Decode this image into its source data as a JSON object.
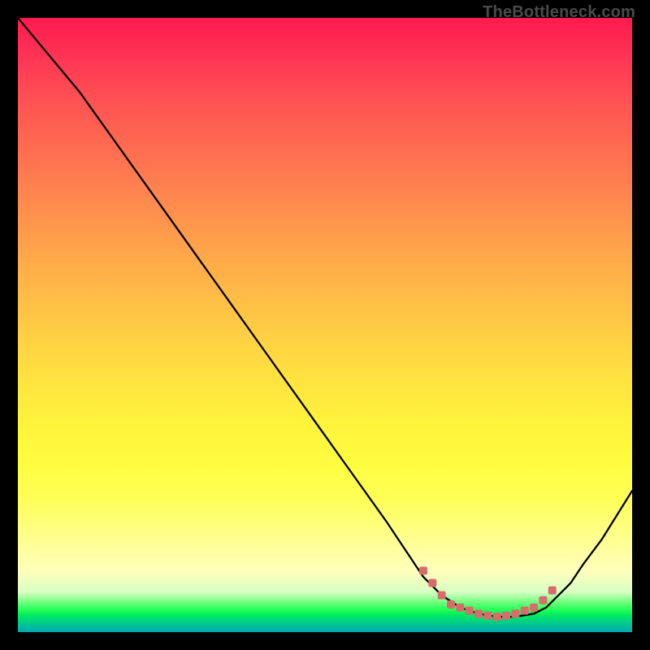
{
  "watermark": "TheBottleneck.com",
  "chart_data": {
    "type": "line",
    "title": "",
    "xlabel": "",
    "ylabel": "",
    "xlim": [
      0,
      100
    ],
    "ylim": [
      0,
      100
    ],
    "grid": false,
    "legend": false,
    "series": [
      {
        "name": "curve",
        "color": "#000000",
        "x": [
          0,
          5,
          10,
          15,
          20,
          25,
          30,
          35,
          40,
          45,
          50,
          55,
          60,
          62,
          64,
          66,
          69,
          72,
          75,
          78,
          81,
          84,
          86,
          88,
          90,
          92,
          95,
          100
        ],
        "y": [
          100,
          94,
          88,
          81,
          74,
          67,
          60,
          53,
          46,
          39,
          32,
          25,
          18,
          15,
          12,
          9,
          6,
          4,
          3,
          2.5,
          2.5,
          3,
          4,
          6,
          8,
          11,
          15,
          23
        ]
      },
      {
        "name": "optimal-zone-markers",
        "color": "#d96b6b",
        "x": [
          66,
          67.5,
          69,
          70.5,
          72,
          73.5,
          75,
          76.5,
          78,
          79.5,
          81,
          82.5,
          84,
          85.5,
          87
        ],
        "y": [
          10,
          8,
          6,
          4.5,
          4,
          3.5,
          3,
          2.7,
          2.5,
          2.7,
          3,
          3.5,
          4,
          5.2,
          6.8
        ]
      }
    ],
    "annotations": []
  }
}
